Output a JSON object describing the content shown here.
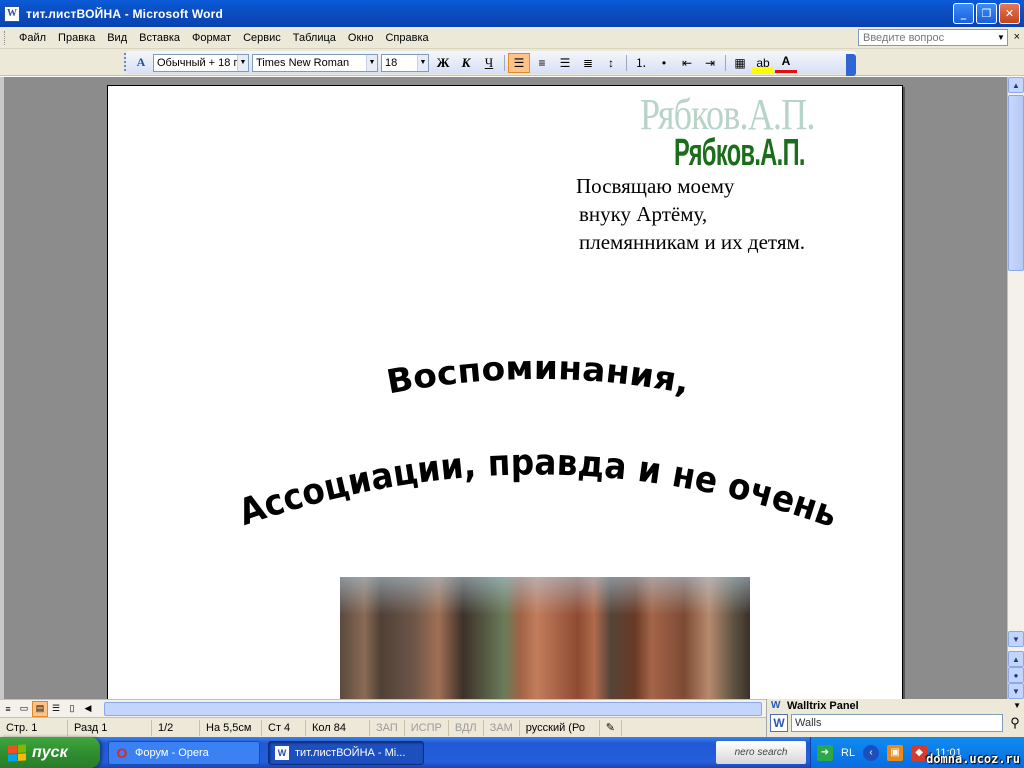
{
  "window": {
    "title": "тит.листВОЙНА - Microsoft Word",
    "app_icon": "word-app-icon",
    "buttons": {
      "minimize": "_",
      "restore": "❐",
      "close": "✕"
    }
  },
  "menubar": {
    "items": [
      "Файл",
      "Правка",
      "Вид",
      "Вставка",
      "Формат",
      "Сервис",
      "Таблица",
      "Окно",
      "Справка"
    ],
    "help_placeholder": "Введите вопрос",
    "doc_close": "×"
  },
  "toolbar": {
    "style_value": "Обычный + 18 г",
    "font_value": "Times New Roman",
    "size_value": "18",
    "bold": "Ж",
    "italic": "К",
    "underline": "Ч"
  },
  "document": {
    "ghost_author": "Рябков.А.П.",
    "author": "Рябков.А.П.",
    "dedication": [
      "Посвящаю моему",
      "внуку  Артёму,",
      "племянникам и их детям."
    ],
    "wordart_line1": "Воспоминания,",
    "wordart_line2": "Ассоциации, правда и не очень",
    "photo": "redwood-forest-photo"
  },
  "statusbar": {
    "page": "Стр. 1",
    "section": "Разд 1",
    "pages": "1/2",
    "at": "На 5,5см",
    "line": "Ст 4",
    "col": "Кол 84",
    "rec": "ЗАП",
    "trk": "ИСПР",
    "ext": "ВДЛ",
    "ovr": "ЗАМ",
    "lang": "русский (Ро"
  },
  "walltrix": {
    "title": "Walltrix Panel",
    "search_value": "Walls"
  },
  "taskbar": {
    "start": "пуск",
    "tasks": [
      "Форум - Opera",
      "тит.листВОЙНА - Mi..."
    ],
    "nero": "nero search",
    "lang": "RL",
    "clock": "11:01",
    "site": "domna.ucoz.ru"
  },
  "colors": {
    "author_green": "#1a6d1a",
    "ghost_green": "#b8d3c8",
    "titlebar_blue": "#0b4fc2",
    "active_button": "#ffc38a"
  }
}
